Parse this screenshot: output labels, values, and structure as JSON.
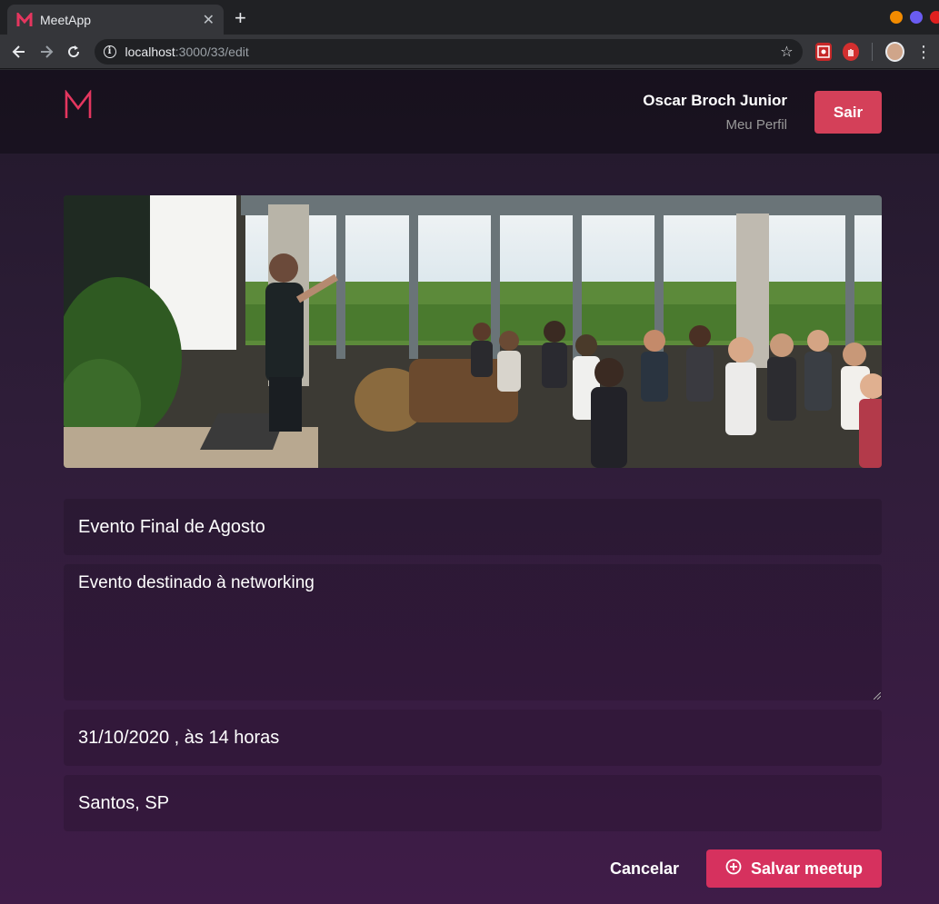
{
  "browser": {
    "tab_title": "MeetApp",
    "url_host": "localhost",
    "url_path": ":3000/33/edit"
  },
  "header": {
    "logo": "M",
    "user_name": "Oscar Broch Junior",
    "profile_link": "Meu Perfil",
    "logout_label": "Sair"
  },
  "form": {
    "title": "Evento Final de Agosto",
    "description": "Evento destinado à networking",
    "date": "31/10/2020 , às  14 horas",
    "location": "Santos, SP",
    "cancel_label": "Cancelar",
    "save_label": "Salvar meetup"
  },
  "colors": {
    "accent": "#d6315e",
    "logo": "#e5365f"
  }
}
